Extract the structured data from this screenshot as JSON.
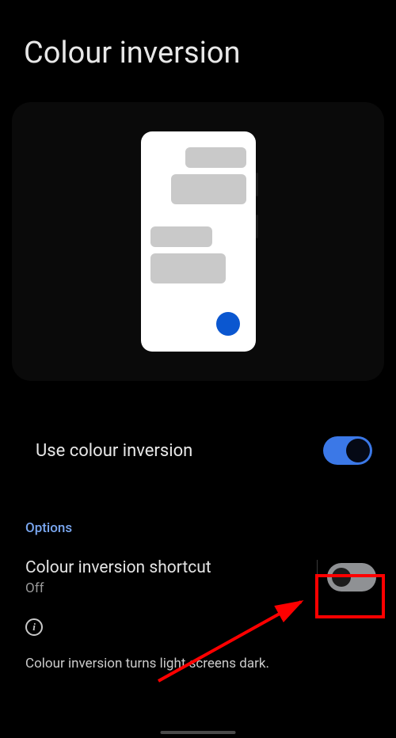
{
  "header": {
    "title": "Colour inversion"
  },
  "settings": {
    "use_inversion": {
      "label": "Use colour inversion",
      "enabled": true
    }
  },
  "options": {
    "header": "Options",
    "shortcut": {
      "title": "Colour inversion shortcut",
      "status": "Off",
      "enabled": false
    }
  },
  "info": {
    "description": "Colour inversion turns light screens dark."
  }
}
